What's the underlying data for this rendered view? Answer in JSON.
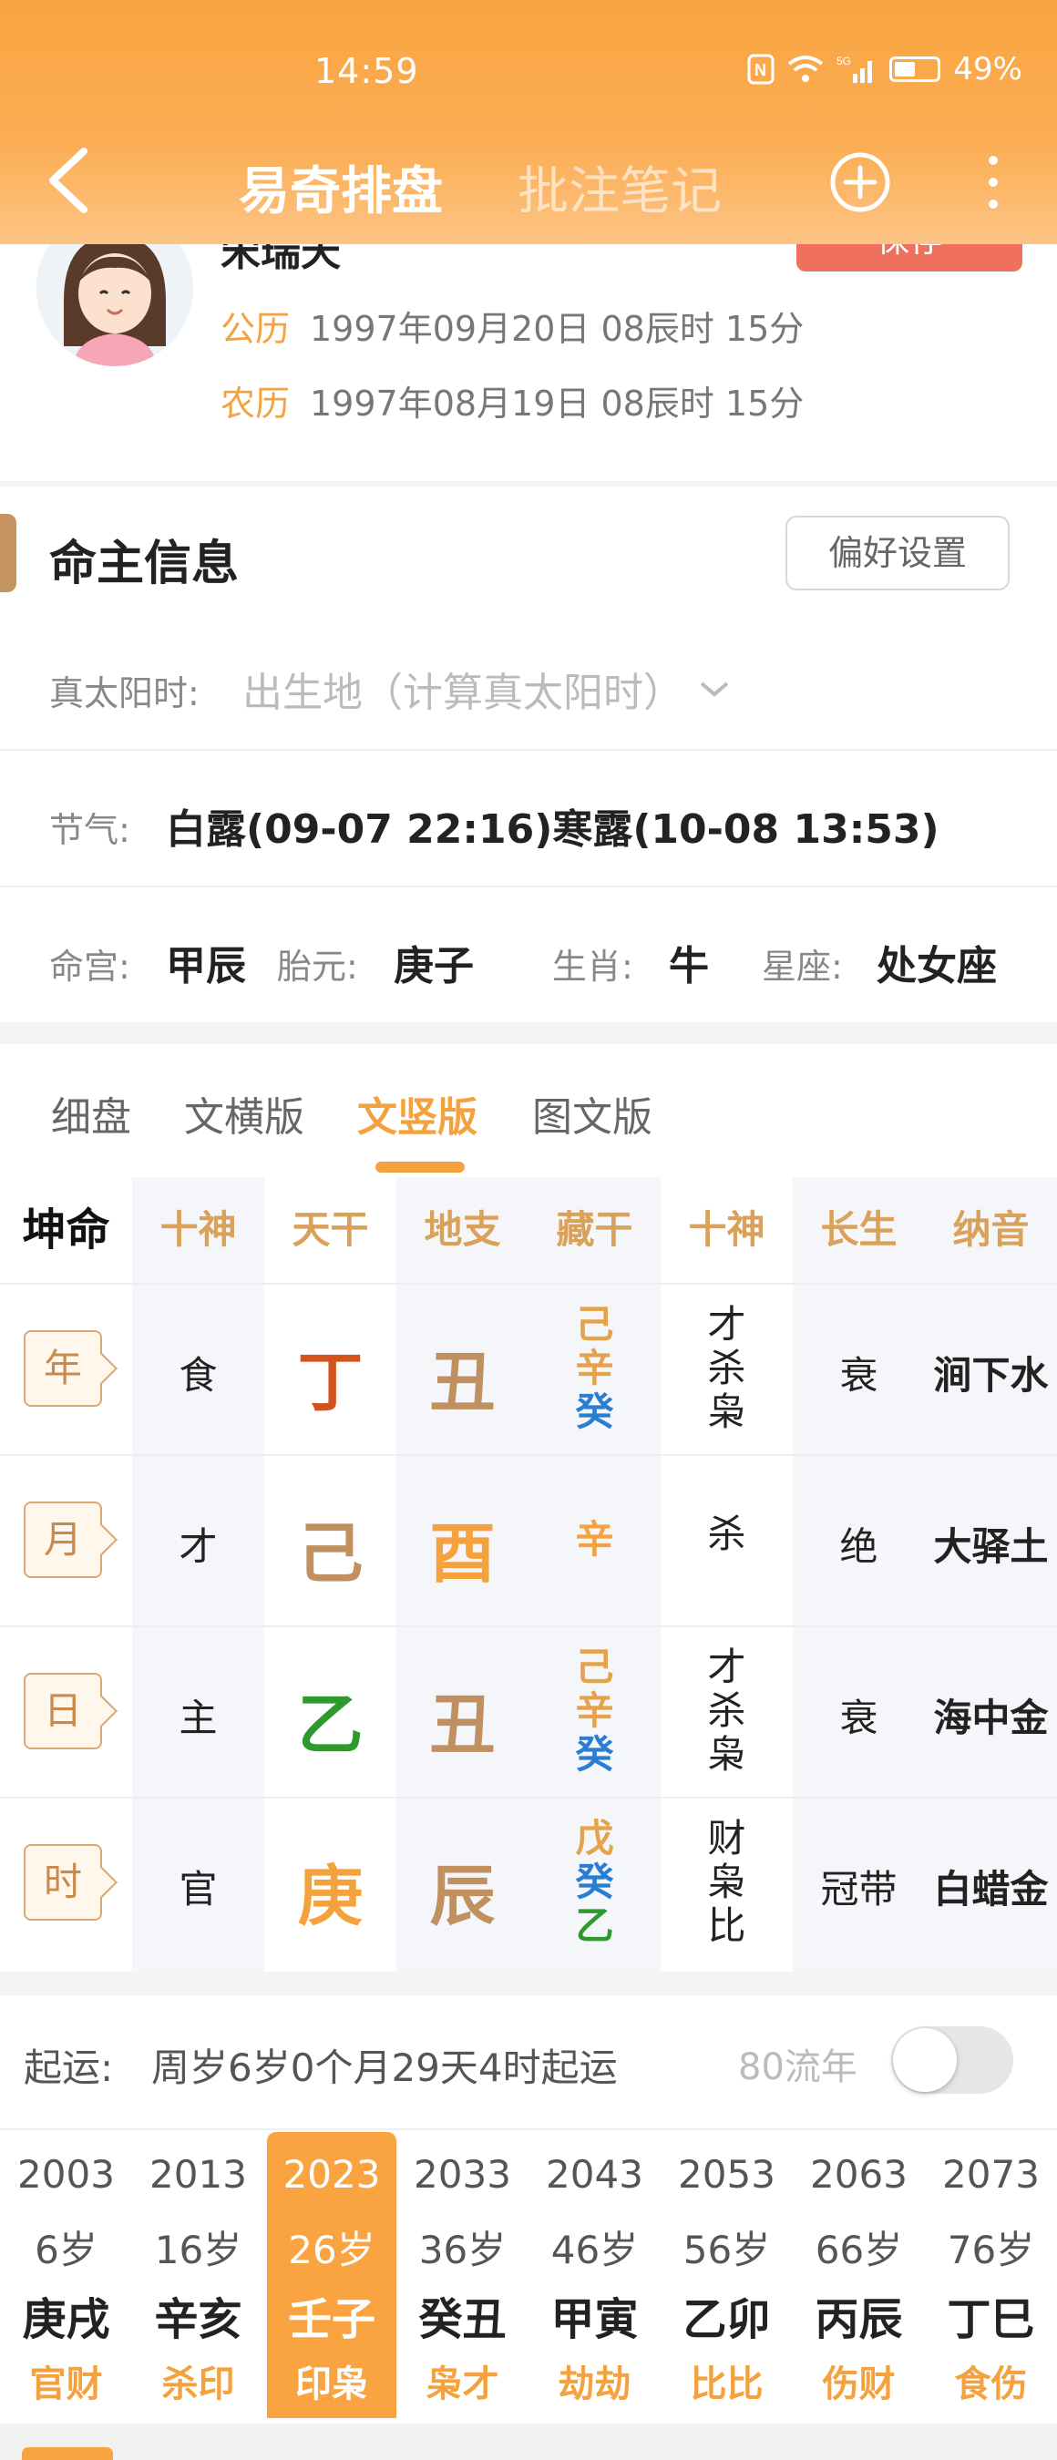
{
  "status_bar": {
    "time": "14:59",
    "battery": "49%",
    "signal": "5G"
  },
  "nav": {
    "title_active": "易奇排盘",
    "title_inactive": "批注笔记"
  },
  "profile": {
    "name_partial": "宋瑞天",
    "save_label": "保存",
    "solar_label": "公历",
    "solar_value": "1997年09月20日 08辰时 15分",
    "lunar_label": "农历",
    "lunar_value": "1997年08月19日 08辰时 15分"
  },
  "info": {
    "section_title": "命主信息",
    "pref_button": "偏好设置",
    "true_solar_label": "真太阳时:",
    "true_solar_placeholder": "出生地（计算真太阳时）",
    "jieqi_label": "节气:",
    "jieqi_value": "白露(09-07 22:16)寒露(10-08 13:53)",
    "minggong_label": "命宫:",
    "minggong_value": "甲辰",
    "taiyuan_label": "胎元:",
    "taiyuan_value": "庚子",
    "shengxiao_label": "生肖:",
    "shengxiao_value": "牛",
    "xingzuo_label": "星座:",
    "xingzuo_value": "处女座"
  },
  "tabs": [
    "细盘",
    "文横版",
    "文竖版",
    "图文版"
  ],
  "active_tab": "文竖版",
  "chart": {
    "headers": [
      "坤命",
      "十神",
      "天干",
      "地支",
      "藏干",
      "十神",
      "长生",
      "纳音"
    ],
    "rows": [
      {
        "pillar": "年",
        "shishen": "食",
        "gan": "丁",
        "gan_color": "#d2541c",
        "zhi": "丑",
        "zhi_color": "#c09061",
        "canggan": [
          {
            "c": "己",
            "color": "#e4a34a"
          },
          {
            "c": "辛",
            "color": "#e4a34a"
          },
          {
            "c": "癸",
            "color": "#2a7dd1"
          }
        ],
        "cang_shishen": [
          "才",
          "杀",
          "枭"
        ],
        "changsheng": "衰",
        "nayin": "涧下水"
      },
      {
        "pillar": "月",
        "shishen": "才",
        "gan": "己",
        "gan_color": "#c09061",
        "zhi": "酉",
        "zhi_color": "#f4a23e",
        "canggan": [
          {
            "c": "辛",
            "color": "#f4a23e"
          }
        ],
        "cang_shishen": [
          "杀"
        ],
        "changsheng": "绝",
        "nayin": "大驿土"
      },
      {
        "pillar": "日",
        "shishen": "主",
        "gan": "乙",
        "gan_color": "#2e9a2e",
        "zhi": "丑",
        "zhi_color": "#c09061",
        "canggan": [
          {
            "c": "己",
            "color": "#e4a34a"
          },
          {
            "c": "辛",
            "color": "#e4a34a"
          },
          {
            "c": "癸",
            "color": "#2a7dd1"
          }
        ],
        "cang_shishen": [
          "才",
          "杀",
          "枭"
        ],
        "changsheng": "衰",
        "nayin": "海中金"
      },
      {
        "pillar": "时",
        "shishen": "官",
        "gan": "庚",
        "gan_color": "#f4a23e",
        "zhi": "辰",
        "zhi_color": "#c09061",
        "canggan": [
          {
            "c": "戊",
            "color": "#e4a34a"
          },
          {
            "c": "癸",
            "color": "#2a7dd1"
          },
          {
            "c": "乙",
            "color": "#2e9a2e"
          }
        ],
        "cang_shishen": [
          "财",
          "枭",
          "比"
        ],
        "changsheng": "冠带",
        "nayin": "白蜡金"
      }
    ]
  },
  "luck": {
    "qiyun_label": "起运:",
    "qiyun_value": "周岁6岁0个月29天4时起运",
    "liunian_label": "80流年",
    "toggle_on": false,
    "dayun": [
      {
        "year": "2003",
        "age": "6岁",
        "gz": "庚戌",
        "ss": "官财"
      },
      {
        "year": "2013",
        "age": "16岁",
        "gz": "辛亥",
        "ss": "杀印"
      },
      {
        "year": "2023",
        "age": "26岁",
        "gz": "壬子",
        "ss": "印枭"
      },
      {
        "year": "2033",
        "age": "36岁",
        "gz": "癸丑",
        "ss": "枭才"
      },
      {
        "year": "2043",
        "age": "46岁",
        "gz": "甲寅",
        "ss": "劫劫"
      },
      {
        "year": "2053",
        "age": "56岁",
        "gz": "乙卯",
        "ss": "比比"
      },
      {
        "year": "2063",
        "age": "66岁",
        "gz": "丙辰",
        "ss": "伤财"
      },
      {
        "year": "2073",
        "age": "76岁",
        "gz": "丁巳",
        "ss": "食伤"
      }
    ],
    "active_index": 2
  },
  "colors": {
    "accent": "#f4a23e",
    "header": "#f9a440",
    "save": "#f0705e",
    "earth": "#c09061",
    "water": "#2a7dd1",
    "wood": "#2e9a2e",
    "fire": "#d2541c"
  },
  "icons": [
    "back-arrow-icon",
    "plus-circle-icon",
    "more-vertical-icon",
    "chevron-down-icon",
    "nfc-icon",
    "wifi-icon",
    "signal-icon",
    "battery-icon"
  ]
}
